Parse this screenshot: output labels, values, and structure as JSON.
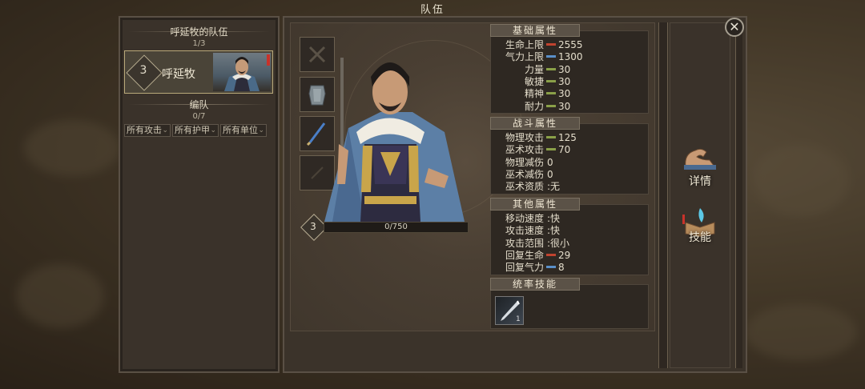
{
  "window": {
    "title": "队伍"
  },
  "team_panel": {
    "team_name": "呼延牧的队伍",
    "team_count": "1/3",
    "hero": {
      "level": "3",
      "name": "呼延牧"
    },
    "formation_label": "编队",
    "formation_count": "0/7",
    "filters": [
      "所有攻击",
      "所有护甲",
      "所有单位"
    ]
  },
  "character": {
    "level": "3",
    "xp_text": "0/750",
    "equipment_slots": [
      "weapon-slot-icon",
      "armor-slot-icon",
      "sword-slot-icon",
      "empty-slot-icon"
    ]
  },
  "sections": {
    "basic": {
      "title": "基础属性",
      "rows": [
        {
          "label": "生命上限",
          "value": "2555",
          "bar_color": "#c0432f"
        },
        {
          "label": "气力上限",
          "value": "1300",
          "bar_color": "#5a8fc8"
        },
        {
          "label": "力量",
          "value": "30",
          "bar_color": "#8aa048"
        },
        {
          "label": "敏捷",
          "value": "30",
          "bar_color": "#8aa048"
        },
        {
          "label": "精神",
          "value": "30",
          "bar_color": "#8aa048"
        },
        {
          "label": "耐力",
          "value": "30",
          "bar_color": "#8aa048"
        }
      ]
    },
    "combat": {
      "title": "战斗属性",
      "rows": [
        {
          "label": "物理攻击",
          "value": "125",
          "bar_color": "#8aa048"
        },
        {
          "label": "巫术攻击",
          "value": "70",
          "bar_color": "#8aa048"
        },
        {
          "label": "物理减伤",
          "value": "0"
        },
        {
          "label": "巫术减伤",
          "value": "0"
        },
        {
          "label": "巫术资质",
          "value": ":无"
        }
      ]
    },
    "other": {
      "title": "其他属性",
      "rows": [
        {
          "label": "移动速度",
          "value": ":快"
        },
        {
          "label": "攻击速度",
          "value": ":快"
        },
        {
          "label": "攻击范围",
          "value": ":很小"
        },
        {
          "label": "回复生命",
          "value": "29",
          "bar_color": "#c0432f"
        },
        {
          "label": "回复气力",
          "value": "8",
          "bar_color": "#5a8fc8"
        }
      ]
    },
    "command_skills": {
      "title": "统率技能",
      "skill_count": "1"
    }
  },
  "side_tabs": [
    {
      "label": "详情",
      "icon": "flexed-arm-icon"
    },
    {
      "label": "技能",
      "icon": "skill-book-icon"
    }
  ],
  "colors": {
    "accent": "#b9a97a",
    "health": "#c0432f",
    "energy": "#5a8fc8",
    "stat": "#8aa048",
    "alert": "#c8322a"
  }
}
